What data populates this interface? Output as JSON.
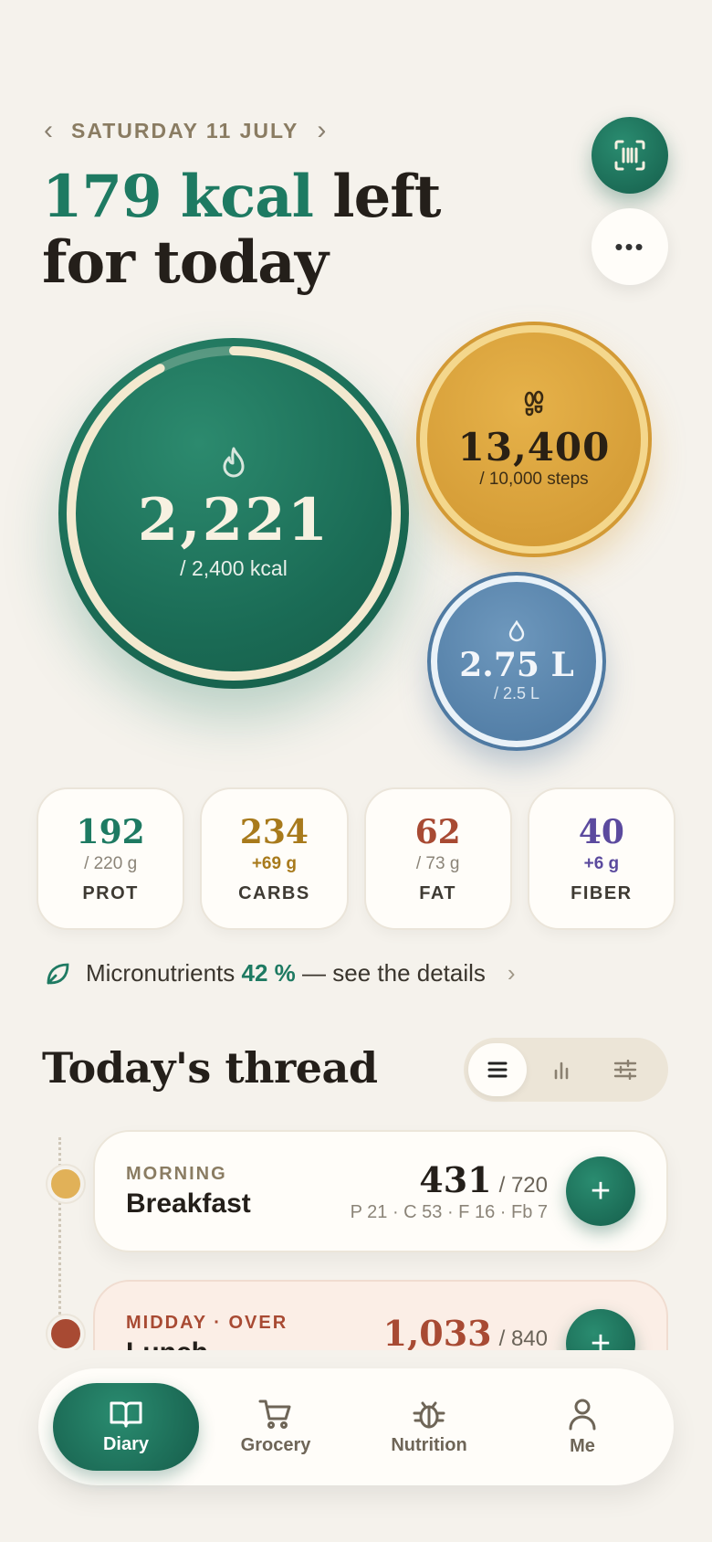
{
  "header": {
    "date": "SATURDAY 11 JULY",
    "headline_accent": "179 kcal",
    "headline_rest_1": " left",
    "headline_rest_2": "for today"
  },
  "bubbles": {
    "calories": {
      "value": "2,221",
      "goal": "/ 2,400 kcal",
      "progress": 0.925
    },
    "steps": {
      "value": "13,400",
      "goal": "/ 10,000 steps"
    },
    "water": {
      "value": "2.75 L",
      "goal": "/ 2.5 L"
    }
  },
  "macros": [
    {
      "value": "192",
      "sub": "/ 220 g",
      "label": "PROT",
      "color": "#1e7a62",
      "sub_color": "#8b8478"
    },
    {
      "value": "234",
      "sub": "+69 g",
      "label": "CARBS",
      "color": "#a87a1c",
      "sub_color": "#a87a1c"
    },
    {
      "value": "62",
      "sub": "/ 73 g",
      "label": "FAT",
      "color": "#a84a33",
      "sub_color": "#8b8478"
    },
    {
      "value": "40",
      "sub": "+6 g",
      "label": "FIBER",
      "color": "#5b4a9e",
      "sub_color": "#5b4a9e"
    }
  ],
  "micronutrients": {
    "prefix": "Micronutrients",
    "percent": "42 %",
    "suffix": "— see the details"
  },
  "thread": {
    "title": "Today's thread",
    "meals": [
      {
        "period": "MORNING",
        "name": "Breakfast",
        "kcal": "431",
        "of": "/ 720",
        "macros": "P 21 · C 53 · F 16 · Fb 7"
      },
      {
        "period": "MIDDAY · OVER",
        "name": "Lunch",
        "kcal": "1,033",
        "of": "/ 840"
      }
    ]
  },
  "nav": [
    {
      "label": "Diary",
      "icon": "book-icon",
      "active": true
    },
    {
      "label": "Grocery",
      "icon": "cart-icon"
    },
    {
      "label": "Nutrition",
      "icon": "bug-icon"
    },
    {
      "label": "Me",
      "icon": "person-icon"
    }
  ]
}
